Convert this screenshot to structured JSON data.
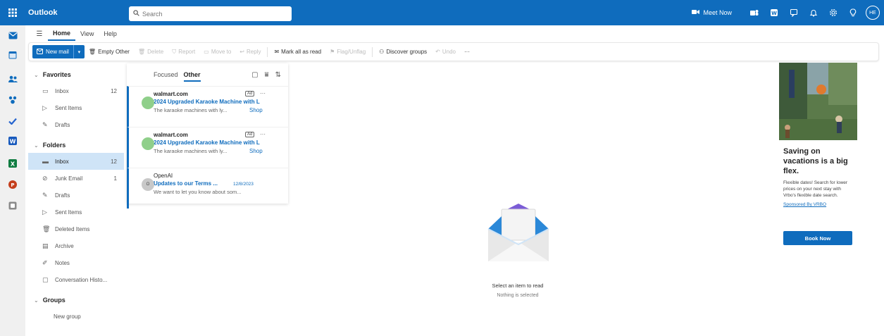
{
  "app": {
    "name": "Outlook"
  },
  "search": {
    "placeholder": "Search"
  },
  "header": {
    "meet_now": "Meet Now",
    "avatar_initials": "HE"
  },
  "ribbon": {
    "tabs": [
      "Home",
      "View",
      "Help"
    ],
    "active_tab": "Home"
  },
  "toolbar": {
    "new_mail": "New mail",
    "empty_other": "Empty Other",
    "delete": "Delete",
    "report": "Report",
    "move_to": "Move to",
    "reply": "Reply",
    "mark_all_read": "Mark all as read",
    "flag": "Flag/Unflag",
    "discover_groups": "Discover groups",
    "undo": "Undo",
    "more": "···"
  },
  "folders": {
    "favorites_label": "Favorites",
    "favorites": [
      {
        "name": "Inbox",
        "count": "12"
      },
      {
        "name": "Sent Items",
        "count": ""
      },
      {
        "name": "Drafts",
        "count": ""
      }
    ],
    "folders_label": "Folders",
    "items": [
      {
        "name": "Inbox",
        "count": "12",
        "selected": true
      },
      {
        "name": "Junk Email",
        "count": "1"
      },
      {
        "name": "Drafts",
        "count": ""
      },
      {
        "name": "Sent Items",
        "count": ""
      },
      {
        "name": "Deleted Items",
        "count": ""
      },
      {
        "name": "Archive",
        "count": ""
      },
      {
        "name": "Notes",
        "count": ""
      },
      {
        "name": "Conversation Histo...",
        "count": ""
      }
    ],
    "groups_label": "Groups",
    "new_group": "New group"
  },
  "message_list": {
    "tabs": [
      "Focused",
      "Other"
    ],
    "active_tab": "Other",
    "messages": [
      {
        "sender": "walmart.com",
        "subject": "2024 Upgraded Karaoke Machine with L",
        "preview": "The karaoke machines with ly...",
        "action": "Shop",
        "ad_tag": "Ad",
        "avatar": "",
        "avatar_color": "#8fcf8a"
      },
      {
        "sender": "walmart.com",
        "subject": "2024 Upgraded Karaoke Machine with L",
        "preview": "The karaoke machines with ly...",
        "action": "Shop",
        "ad_tag": "Ad",
        "avatar": "",
        "avatar_color": "#8fcf8a"
      },
      {
        "sender": "OpenAI",
        "subject": "Updates to our Terms ...",
        "date": "12/8/2023",
        "preview": "We want to let you know about som...",
        "avatar": "O",
        "avatar_color": "#c8c8c8"
      }
    ]
  },
  "reading_pane": {
    "empty_title": "Select an item to read",
    "empty_sub": "Nothing is selected"
  },
  "ad": {
    "headline": "Saving on vacations is a big flex.",
    "body": "Flexible dates! Search for lower prices on your next stay with Vrbo's flexible date search.",
    "sponsor": "Sponsored By VRBO",
    "button": "Book Now"
  },
  "colors": {
    "brand": "#0f6cbd",
    "selected_folder": "#cfe4f7"
  }
}
